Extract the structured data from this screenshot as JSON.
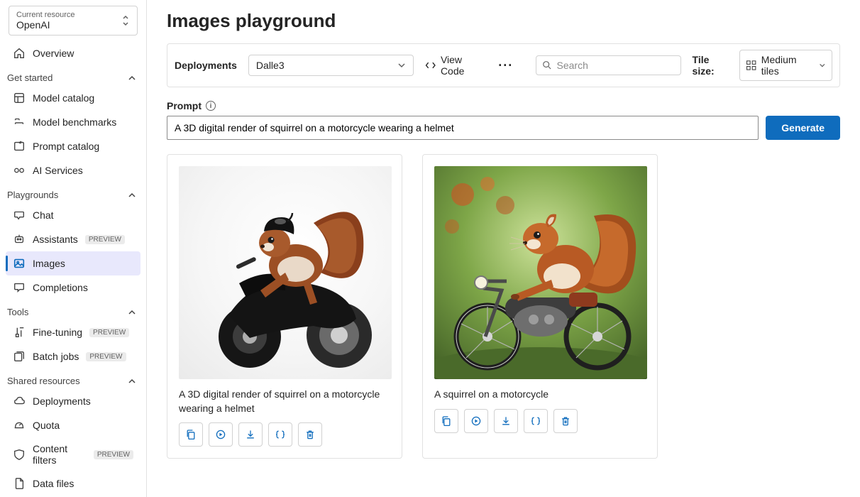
{
  "resource": {
    "label": "Current resource",
    "value": "OpenAI"
  },
  "sidebar": {
    "overview": "Overview",
    "sections": {
      "get_started": {
        "title": "Get started",
        "items": [
          {
            "label": "Model catalog",
            "name": "model-catalog"
          },
          {
            "label": "Model benchmarks",
            "name": "model-benchmarks"
          },
          {
            "label": "Prompt catalog",
            "name": "prompt-catalog"
          },
          {
            "label": "AI Services",
            "name": "ai-services"
          }
        ]
      },
      "playgrounds": {
        "title": "Playgrounds",
        "items": [
          {
            "label": "Chat",
            "name": "chat",
            "badge": null
          },
          {
            "label": "Assistants",
            "name": "assistants",
            "badge": "PREVIEW"
          },
          {
            "label": "Images",
            "name": "images",
            "badge": null,
            "active": true
          },
          {
            "label": "Completions",
            "name": "completions",
            "badge": null
          }
        ]
      },
      "tools": {
        "title": "Tools",
        "items": [
          {
            "label": "Fine-tuning",
            "name": "fine-tuning",
            "badge": "PREVIEW"
          },
          {
            "label": "Batch jobs",
            "name": "batch-jobs",
            "badge": "PREVIEW"
          }
        ]
      },
      "shared": {
        "title": "Shared resources",
        "items": [
          {
            "label": "Deployments",
            "name": "deployments",
            "badge": null
          },
          {
            "label": "Quota",
            "name": "quota",
            "badge": null
          },
          {
            "label": "Content filters",
            "name": "content-filters",
            "badge": "PREVIEW"
          },
          {
            "label": "Data files",
            "name": "data-files",
            "badge": null
          }
        ]
      }
    }
  },
  "page_title": "Images playground",
  "toolbar": {
    "deployments_label": "Deployments",
    "deployment_selected": "Dalle3",
    "view_code": "View Code",
    "search_placeholder": "Search",
    "tile_size_label": "Tile size:",
    "tile_size_value": "Medium tiles"
  },
  "prompt": {
    "label": "Prompt",
    "value": "A 3D digital render of squirrel on a motorcycle wearing a helmet",
    "generate": "Generate"
  },
  "cards": [
    {
      "caption": "A 3D digital render of squirrel on a motorcycle wearing a helmet"
    },
    {
      "caption": "A squirrel on a motorcycle"
    }
  ]
}
